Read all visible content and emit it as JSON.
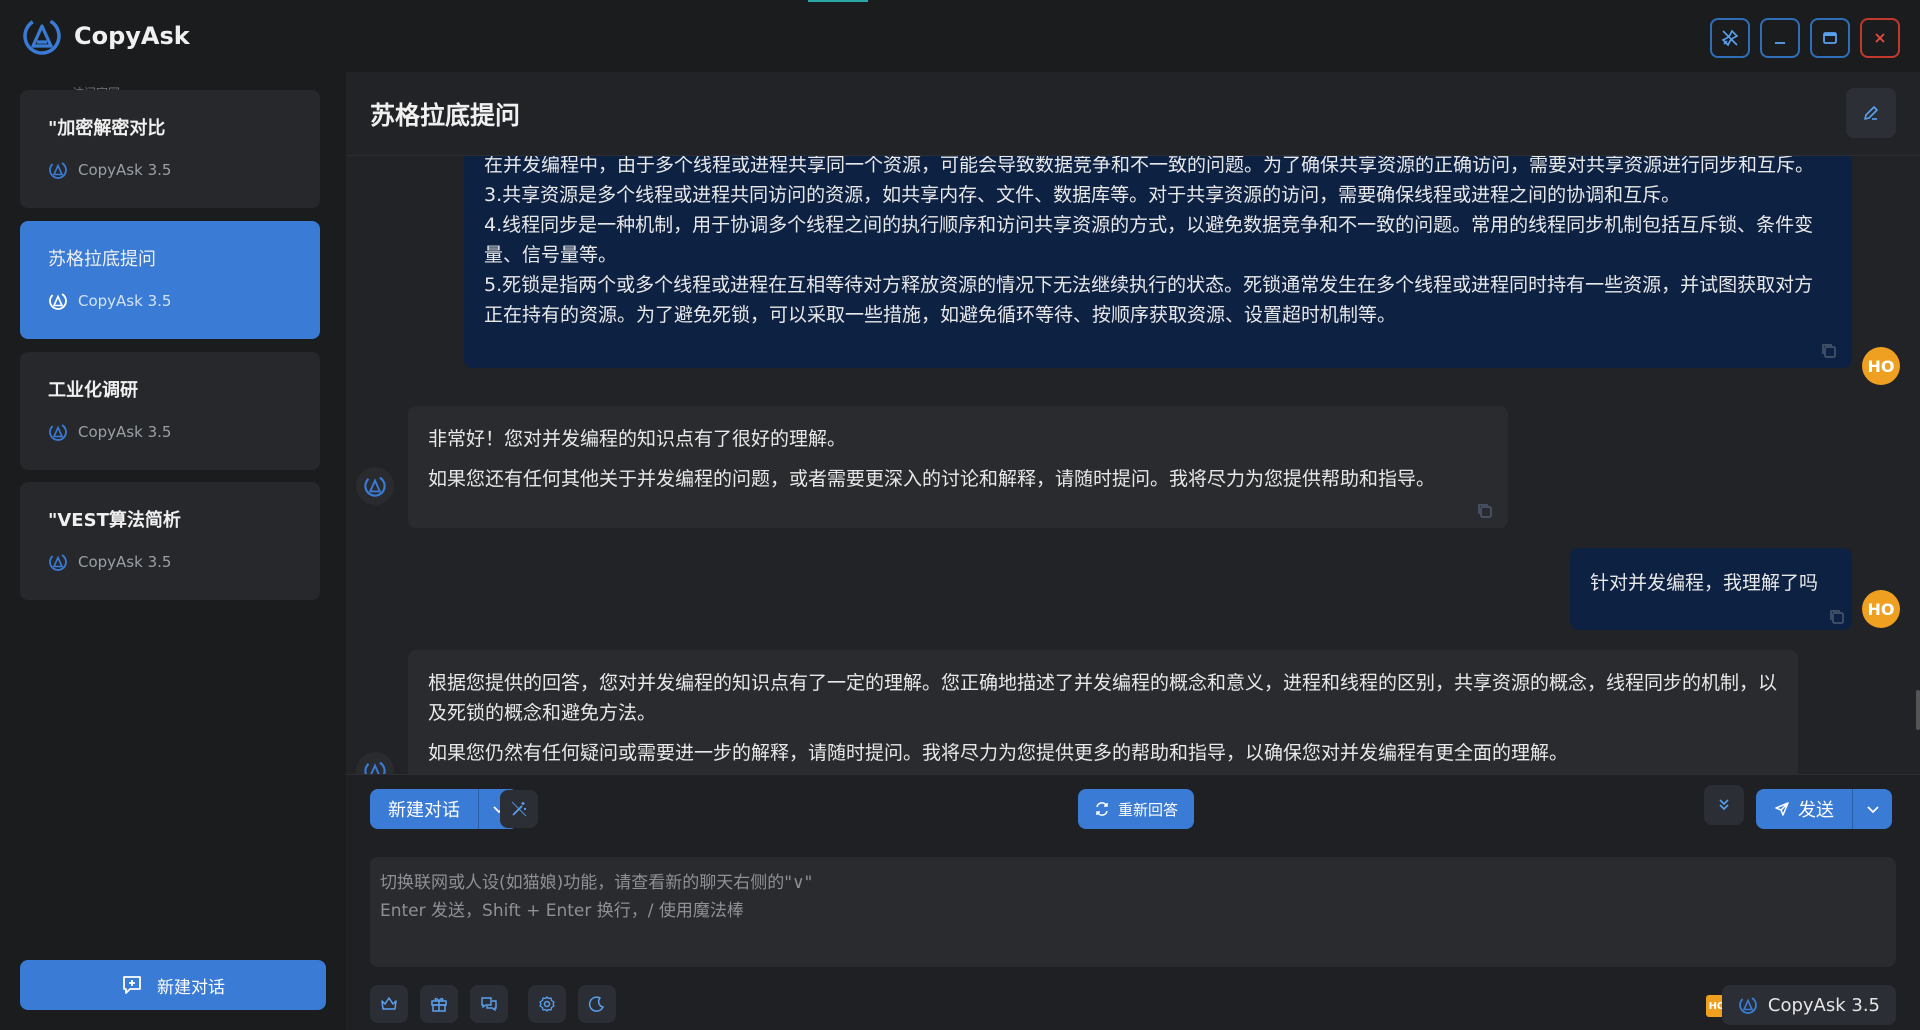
{
  "app": {
    "title": "CopyAsk"
  },
  "window_controls": [
    "pin-icon",
    "minimize-icon",
    "maximize-icon",
    "close-icon"
  ],
  "sidebar": {
    "visit_site": "访问官网",
    "conversations": [
      {
        "title": "\"加密解密对比",
        "model": "CopyAsk 3.5",
        "active": false
      },
      {
        "title": "苏格拉底提问",
        "model": "CopyAsk 3.5",
        "active": true
      },
      {
        "title": "工业化调研",
        "model": "CopyAsk 3.5",
        "active": false
      },
      {
        "title": "\"VEST算法简析",
        "model": "CopyAsk 3.5",
        "active": false
      }
    ],
    "new_chat_label": "新建对话"
  },
  "main": {
    "title": "苏格拉底提问"
  },
  "messages": [
    {
      "role": "user",
      "avatar": "HO",
      "lines": [
        "在并发编程中，由于多个线程或进程共享同一个资源，可能会导致数据竞争和不一致的问题。为了确保共享资源的正确访问，需要对共享资源进行同步和互斥。",
        "3.共享资源是多个线程或进程共同访问的资源，如共享内存、文件、数据库等。对于共享资源的访问，需要确保线程或进程之间的协调和互斥。",
        "4.线程同步是一种机制，用于协调多个线程之间的执行顺序和访问共享资源的方式，以避免数据竞争和不一致的问题。常用的线程同步机制包括互斥锁、条件变量、信号量等。",
        "5.死锁是指两个或多个线程或进程在互相等待对方释放资源的情况下无法继续执行的状态。死锁通常发生在多个线程或进程同时持有一些资源，并试图获取对方正在持有的资源。为了避免死锁，可以采取一些措施，如避免循环等待、按顺序获取资源、设置超时机制等。"
      ]
    },
    {
      "role": "assistant",
      "paragraphs": [
        "非常好！您对并发编程的知识点有了很好的理解。",
        "如果您还有任何其他关于并发编程的问题，或者需要更深入的讨论和解释，请随时提问。我将尽力为您提供帮助和指导。"
      ]
    },
    {
      "role": "user",
      "avatar": "HO",
      "text": "针对并发编程，我理解了吗"
    },
    {
      "role": "assistant",
      "paragraphs": [
        "根据您提供的回答，您对并发编程的知识点有了一定的理解。您正确地描述了并发编程的概念和意义，进程和线程的区别，共享资源的概念，线程同步的机制，以及死锁的概念和避免方法。",
        "如果您仍然有任何疑问或需要进一步的解释，请随时提问。我将尽力为您提供更多的帮助和指导，以确保您对并发编程有更全面的理解。"
      ]
    }
  ],
  "composer": {
    "new_chat_label": "新建对话",
    "regenerate_label": "重新回答",
    "send_label": "发送",
    "placeholder_line1": "切换联网或人设(如猫娘)功能，请查看新的聊天右侧的\"∨\"",
    "placeholder_line2": "Enter 发送，Shift + Enter 换行，/ 使用魔法棒",
    "tools": [
      "crown-icon",
      "gift-icon",
      "chat-bubbles-icon",
      "settings-icon",
      "moon-icon"
    ],
    "user_badge": "HO",
    "model": "CopyAsk 3.5"
  },
  "colors": {
    "accent": "#3a7bd5",
    "user_bubble": "#0d2143",
    "avatar": "#f0a020",
    "danger": "#e74c3c"
  }
}
